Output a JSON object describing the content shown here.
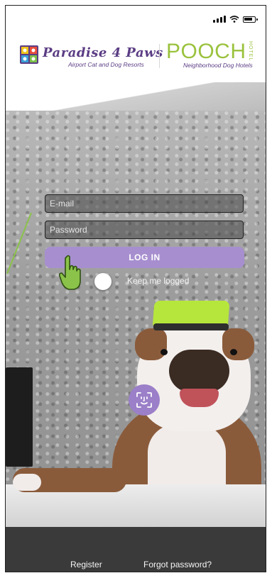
{
  "header": {
    "brand1_title": "Paradise 4 Paws",
    "brand1_subtitle": "Airport Cat and Dog Resorts",
    "brand2_title": "POOCH",
    "brand2_badge": "HOTEL",
    "brand2_subtitle": "Neighborhood Dog Hotels"
  },
  "form": {
    "email_placeholder": "E-mail",
    "email_value": "",
    "password_placeholder": "Password",
    "password_value": "",
    "login_label": "LOG IN",
    "keep_logged_label": "Keep me logged",
    "keep_logged_on": false
  },
  "footer": {
    "register_label": "Register",
    "forgot_label": "Forgot password?"
  },
  "colors": {
    "primary_purple": "#a78fcf",
    "brand_purple": "#5b3d84",
    "pooch_green": "#9ac23c",
    "pointer_green": "#8bc34a"
  },
  "icons": [
    "signal-icon",
    "wifi-icon",
    "battery-icon",
    "paw-logo-icon",
    "hand-pointer-icon",
    "face-id-icon"
  ]
}
